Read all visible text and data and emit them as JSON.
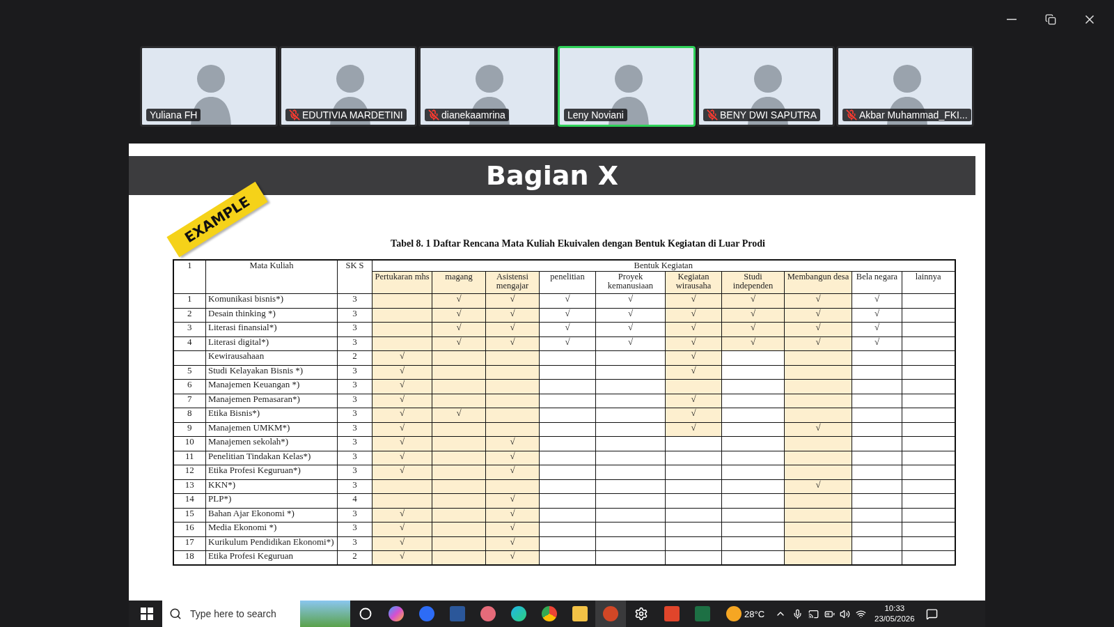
{
  "participants": [
    {
      "name": "Yuliana FH",
      "muted": false,
      "active": false
    },
    {
      "name": "EDUTIVIA MARDETINI",
      "muted": true,
      "active": false
    },
    {
      "name": "dianekaamrina",
      "muted": true,
      "active": false
    },
    {
      "name": "Leny Noviani",
      "muted": false,
      "active": true
    },
    {
      "name": "BENY DWI SAPUTRA",
      "muted": true,
      "active": false
    },
    {
      "name": "Akbar Muhammad_FKI...",
      "muted": true,
      "active": false
    }
  ],
  "slide": {
    "title": "Bagian X",
    "ribbon": "EXAMPLE",
    "caption": "Tabel 8. 1 Daftar Rencana Mata Kuliah Ekuivalen dengan Bentuk Kegiatan di Luar Prodi",
    "table": {
      "corner": "1",
      "course_header": "Mata Kuliah",
      "sks_header": "SK S",
      "group_header": "Bentuk Kegiatan",
      "columns": [
        {
          "label": "Pertukaran mhs"
        },
        {
          "label": "magang"
        },
        {
          "label": "Asistensi mengajar"
        },
        {
          "label": "penelitian"
        },
        {
          "label": "Proyek kemanusiaan"
        },
        {
          "label": "Kegiatan wirausaha"
        },
        {
          "label": "Studi independen"
        },
        {
          "label": "Membangun desa"
        },
        {
          "label": "Bela negara"
        },
        {
          "label": "lainnya"
        }
      ],
      "rows": [
        {
          "no": "1",
          "course": "Komunikasi bisnis*)",
          "sks": "3",
          "cells": [
            {
              "shaded": true
            },
            {
              "shaded": true,
              "value": "√"
            },
            {
              "shaded": true,
              "value": "√"
            },
            {
              "shaded": false,
              "value": "√"
            },
            {
              "shaded": false,
              "value": "√"
            },
            {
              "shaded": true,
              "value": "√"
            },
            {
              "shaded": true,
              "value": "√"
            },
            {
              "shaded": true,
              "value": "√"
            },
            {
              "shaded": false,
              "value": "√"
            },
            {
              "shaded": false
            }
          ]
        },
        {
          "no": "2",
          "course": "Desain thinking *)",
          "sks": "3",
          "cells": [
            {
              "shaded": true
            },
            {
              "shaded": true,
              "value": "√"
            },
            {
              "shaded": true,
              "value": "√"
            },
            {
              "shaded": false,
              "value": "√"
            },
            {
              "shaded": false,
              "value": "√"
            },
            {
              "shaded": true,
              "value": "√"
            },
            {
              "shaded": true,
              "value": "√"
            },
            {
              "shaded": true,
              "value": "√"
            },
            {
              "shaded": false,
              "value": "√"
            },
            {
              "shaded": false
            }
          ]
        },
        {
          "no": "3",
          "course": "Literasi finansial*)",
          "sks": "3",
          "cells": [
            {
              "shaded": true
            },
            {
              "shaded": true,
              "value": "√"
            },
            {
              "shaded": true,
              "value": "√"
            },
            {
              "shaded": false,
              "value": "√"
            },
            {
              "shaded": false,
              "value": "√"
            },
            {
              "shaded": true,
              "value": "√"
            },
            {
              "shaded": true,
              "value": "√"
            },
            {
              "shaded": true,
              "value": "√"
            },
            {
              "shaded": false,
              "value": "√"
            },
            {
              "shaded": false
            }
          ]
        },
        {
          "no": "4",
          "course": "Literasi digital*)",
          "sks": "3",
          "cells": [
            {
              "shaded": true
            },
            {
              "shaded": true,
              "value": "√"
            },
            {
              "shaded": true,
              "value": "√"
            },
            {
              "shaded": false,
              "value": "√"
            },
            {
              "shaded": false,
              "value": "√"
            },
            {
              "shaded": true,
              "value": "√"
            },
            {
              "shaded": true,
              "value": "√"
            },
            {
              "shaded": true,
              "value": "√"
            },
            {
              "shaded": false,
              "value": "√"
            },
            {
              "shaded": false
            }
          ]
        },
        {
          "course": "Kewirausahaan",
          "sks": "2",
          "cells": [
            {
              "shaded": true,
              "value": "√"
            },
            {
              "shaded": true
            },
            {
              "shaded": true
            },
            {
              "shaded": false
            },
            {
              "shaded": false
            },
            {
              "shaded": true,
              "value": "√"
            },
            {
              "shaded": false
            },
            {
              "shaded": true
            },
            {
              "shaded": false
            },
            {
              "shaded": false
            }
          ]
        },
        {
          "no": "5",
          "course": "Studi Kelayakan Bisnis *)",
          "sks": "3",
          "cells": [
            {
              "shaded": true,
              "value": "√"
            },
            {
              "shaded": true
            },
            {
              "shaded": true
            },
            {
              "shaded": false
            },
            {
              "shaded": false
            },
            {
              "shaded": true,
              "value": "√"
            },
            {
              "shaded": false
            },
            {
              "shaded": true
            },
            {
              "shaded": false
            },
            {
              "shaded": false
            }
          ]
        },
        {
          "no": "6",
          "course": "Manajemen Keuangan *)",
          "sks": "3",
          "cells": [
            {
              "shaded": true,
              "value": "√"
            },
            {
              "shaded": true
            },
            {
              "shaded": true
            },
            {
              "shaded": false
            },
            {
              "shaded": false
            },
            {
              "shaded": true
            },
            {
              "shaded": false
            },
            {
              "shaded": true
            },
            {
              "shaded": false
            },
            {
              "shaded": false
            }
          ]
        },
        {
          "no": "7",
          "course": "Manajemen Pemasaran*)",
          "sks": "3",
          "cells": [
            {
              "shaded": true,
              "value": "√"
            },
            {
              "shaded": true
            },
            {
              "shaded": true
            },
            {
              "shaded": false
            },
            {
              "shaded": false
            },
            {
              "shaded": true,
              "value": "√"
            },
            {
              "shaded": false
            },
            {
              "shaded": true
            },
            {
              "shaded": false
            },
            {
              "shaded": false
            }
          ]
        },
        {
          "no": "8",
          "course": "Etika Bisnis*)",
          "sks": "3",
          "cells": [
            {
              "shaded": true,
              "value": "√"
            },
            {
              "shaded": true,
              "value": "√"
            },
            {
              "shaded": true
            },
            {
              "shaded": false
            },
            {
              "shaded": false
            },
            {
              "shaded": true,
              "value": "√"
            },
            {
              "shaded": false
            },
            {
              "shaded": true
            },
            {
              "shaded": false
            },
            {
              "shaded": false
            }
          ]
        },
        {
          "no": "9",
          "course": "Manajemen UMKM*)",
          "sks": "3",
          "cells": [
            {
              "shaded": true,
              "value": "√"
            },
            {
              "shaded": true
            },
            {
              "shaded": true
            },
            {
              "shaded": false
            },
            {
              "shaded": false
            },
            {
              "shaded": true,
              "value": "√"
            },
            {
              "shaded": false
            },
            {
              "shaded": true,
              "value": "√"
            },
            {
              "shaded": false
            },
            {
              "shaded": false
            }
          ]
        },
        {
          "no": "10",
          "course": "Manajemen sekolah*)",
          "sks": "3",
          "cells": [
            {
              "shaded": true,
              "value": "√"
            },
            {
              "shaded": true
            },
            {
              "shaded": true,
              "value": "√"
            },
            {
              "shaded": false
            },
            {
              "shaded": false
            },
            {
              "shaded": false
            },
            {
              "shaded": false
            },
            {
              "shaded": true
            },
            {
              "shaded": false
            },
            {
              "shaded": false
            }
          ]
        },
        {
          "no": "11",
          "course": "Penelitian Tindakan Kelas*)",
          "sks": "3",
          "cells": [
            {
              "shaded": true,
              "value": "√"
            },
            {
              "shaded": true
            },
            {
              "shaded": true,
              "value": "√"
            },
            {
              "shaded": false
            },
            {
              "shaded": false
            },
            {
              "shaded": false
            },
            {
              "shaded": false
            },
            {
              "shaded": true
            },
            {
              "shaded": false
            },
            {
              "shaded": false
            }
          ]
        },
        {
          "no": "12",
          "course": "Etika Profesi Keguruan*)",
          "sks": "3",
          "cells": [
            {
              "shaded": true,
              "value": "√"
            },
            {
              "shaded": true
            },
            {
              "shaded": true,
              "value": "√"
            },
            {
              "shaded": false
            },
            {
              "shaded": false
            },
            {
              "shaded": false
            },
            {
              "shaded": false
            },
            {
              "shaded": true
            },
            {
              "shaded": false
            },
            {
              "shaded": false
            }
          ]
        },
        {
          "no": "13",
          "course": "KKN*)",
          "sks": "3",
          "cells": [
            {
              "shaded": true
            },
            {
              "shaded": true
            },
            {
              "shaded": true
            },
            {
              "shaded": false
            },
            {
              "shaded": false
            },
            {
              "shaded": false
            },
            {
              "shaded": false
            },
            {
              "shaded": true,
              "value": "√"
            },
            {
              "shaded": false
            },
            {
              "shaded": false
            }
          ]
        },
        {
          "no": "14",
          "course": "PLP*)",
          "sks": "4",
          "cells": [
            {
              "shaded": true
            },
            {
              "shaded": true
            },
            {
              "shaded": true,
              "value": "√"
            },
            {
              "shaded": false
            },
            {
              "shaded": false
            },
            {
              "shaded": false
            },
            {
              "shaded": false
            },
            {
              "shaded": true
            },
            {
              "shaded": false
            },
            {
              "shaded": false
            }
          ]
        },
        {
          "no": "15",
          "course": "Bahan Ajar Ekonomi *)",
          "sks": "3",
          "cells": [
            {
              "shaded": true,
              "value": "√"
            },
            {
              "shaded": true
            },
            {
              "shaded": true,
              "value": "√"
            },
            {
              "shaded": false
            },
            {
              "shaded": false
            },
            {
              "shaded": false
            },
            {
              "shaded": false
            },
            {
              "shaded": true
            },
            {
              "shaded": false
            },
            {
              "shaded": false
            }
          ]
        },
        {
          "no": "16",
          "course": "Media Ekonomi *)",
          "sks": "3",
          "cells": [
            {
              "shaded": true,
              "value": "√"
            },
            {
              "shaded": true
            },
            {
              "shaded": true,
              "value": "√"
            },
            {
              "shaded": false
            },
            {
              "shaded": false
            },
            {
              "shaded": false
            },
            {
              "shaded": false
            },
            {
              "shaded": true
            },
            {
              "shaded": false
            },
            {
              "shaded": false
            }
          ]
        },
        {
          "no": "17",
          "course": "Kurikulum Pendidikan Ekonomi*)",
          "sks": "3",
          "cells": [
            {
              "shaded": true,
              "value": "√"
            },
            {
              "shaded": true
            },
            {
              "shaded": true,
              "value": "√"
            },
            {
              "shaded": false
            },
            {
              "shaded": false
            },
            {
              "shaded": false
            },
            {
              "shaded": false
            },
            {
              "shaded": true
            },
            {
              "shaded": false
            },
            {
              "shaded": false
            }
          ]
        },
        {
          "no": "18",
          "course": "Etika Profesi Keguruan",
          "sks": "2",
          "cells": [
            {
              "shaded": true,
              "value": "√"
            },
            {
              "shaded": true
            },
            {
              "shaded": true,
              "value": "√"
            },
            {
              "shaded": false
            },
            {
              "shaded": false
            },
            {
              "shaded": false
            },
            {
              "shaded": false
            },
            {
              "shaded": true
            },
            {
              "shaded": false
            },
            {
              "shaded": false
            }
          ]
        }
      ]
    }
  },
  "taskbar": {
    "search": {
      "placeholder": "Type here to search"
    },
    "weather": "28°C",
    "time": "10:33",
    "date": "23/05/2026"
  }
}
